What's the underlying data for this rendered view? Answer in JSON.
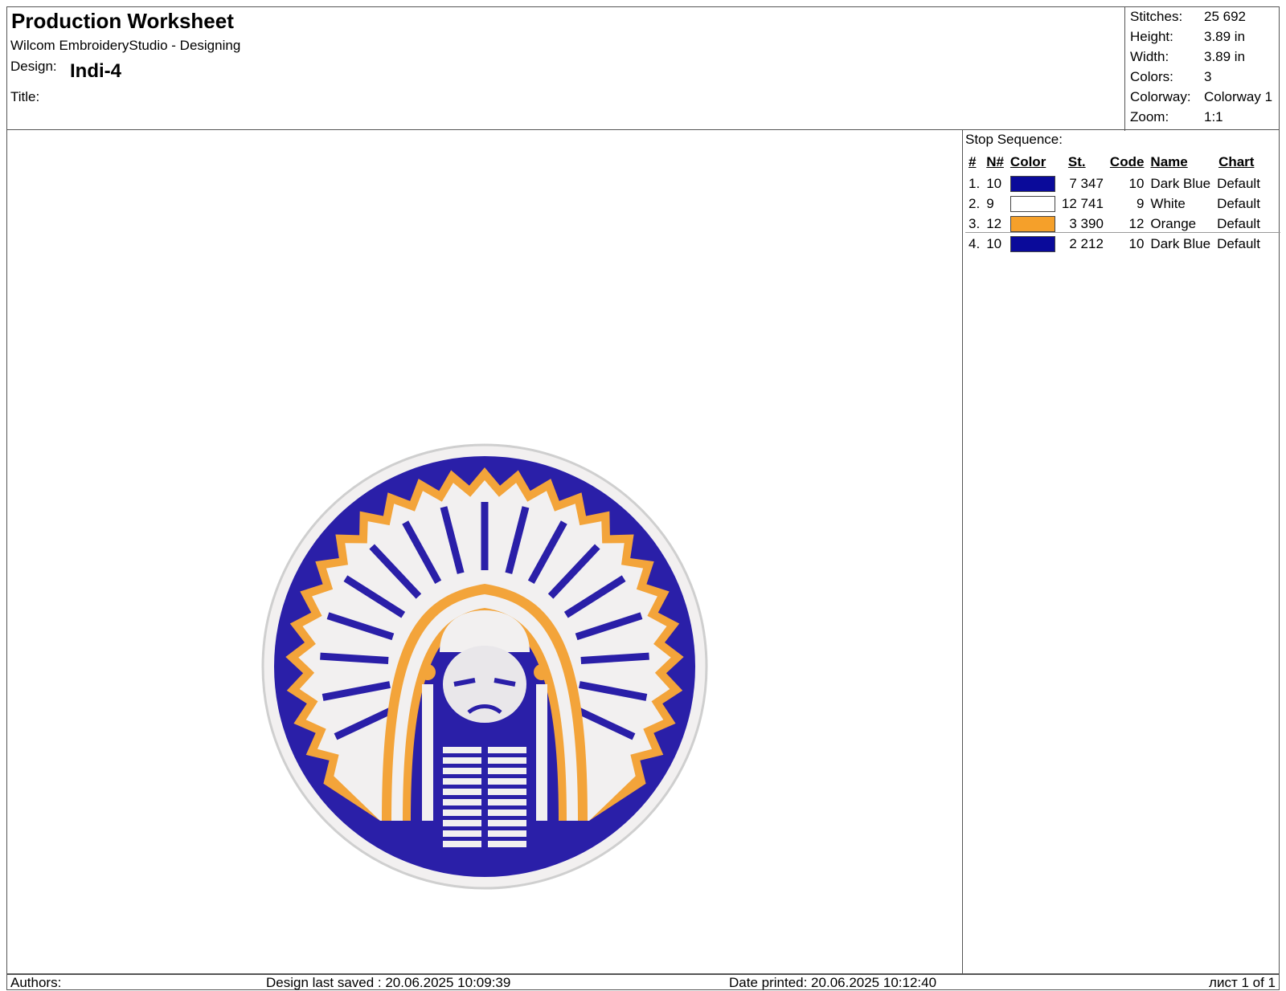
{
  "header": {
    "title": "Production Worksheet",
    "app": "Wilcom EmbroideryStudio - Designing",
    "design_label": "Design:",
    "design_value": "Indi-4",
    "title_label": "Title:"
  },
  "stats": [
    {
      "label": "Stitches:",
      "value": "25 692"
    },
    {
      "label": "Height:",
      "value": "3.89 in"
    },
    {
      "label": "Width:",
      "value": "3.89 in"
    },
    {
      "label": "Colors:",
      "value": "3"
    },
    {
      "label": "Colorway:",
      "value": "Colorway 1"
    },
    {
      "label": "Zoom:",
      "value": "1:1"
    }
  ],
  "stop_sequence": {
    "title": "Stop Sequence:",
    "columns": [
      "#",
      "N#",
      "Color",
      "St.",
      "Code",
      "Name",
      "Chart"
    ],
    "rows": [
      {
        "idx": "1.",
        "n": "10",
        "color": "#0a0a9a",
        "st": "7 347",
        "code": "10",
        "name": "Dark Blue",
        "chart": "Default"
      },
      {
        "idx": "2.",
        "n": "9",
        "color": "#ffffff",
        "st": "12 741",
        "code": "9",
        "name": "White",
        "chart": "Default"
      },
      {
        "idx": "3.",
        "n": "12",
        "color": "#f5a02a",
        "st": "3 390",
        "code": "12",
        "name": "Orange",
        "chart": "Default"
      },
      {
        "idx": "4.",
        "n": "10",
        "color": "#0a0a9a",
        "st": "2 212",
        "code": "10",
        "name": "Dark Blue",
        "chart": "Default"
      }
    ]
  },
  "footer": {
    "authors": "Authors:",
    "last_saved": "Design last saved : 20.06.2025 10:09:39",
    "date_printed": "Date printed: 20.06.2025 10:12:40",
    "page": "лист 1 of 1"
  },
  "colors": {
    "blue": "#2a1fa8",
    "orange": "#f3a43a",
    "white": "#f2f0f0"
  }
}
